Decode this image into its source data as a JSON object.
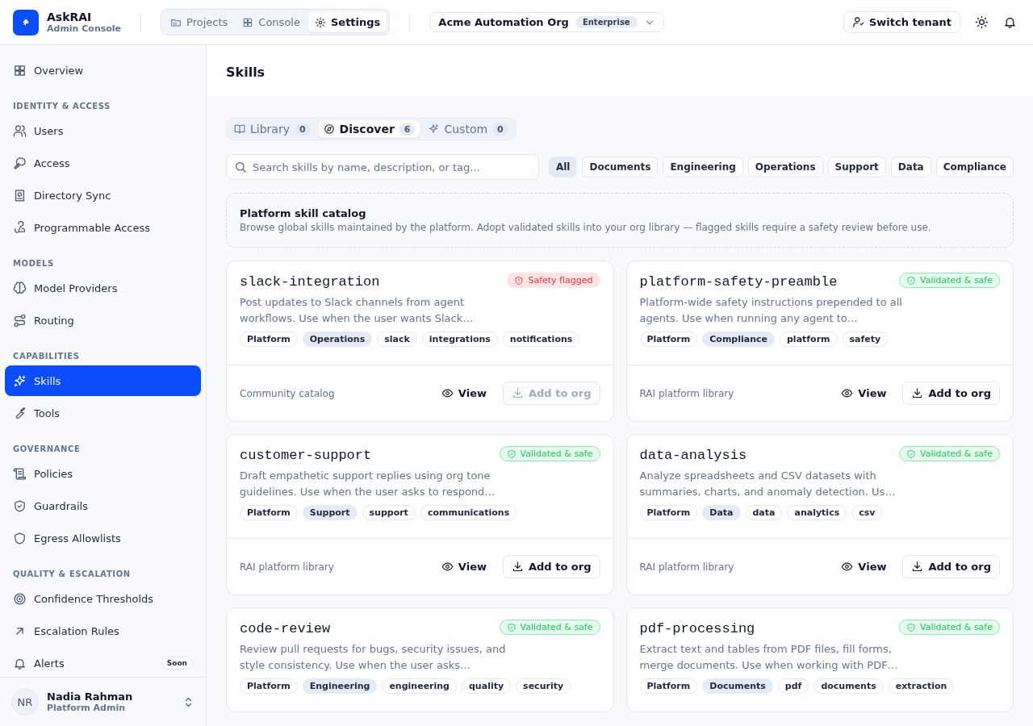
{
  "brand": {
    "name": "AskRAI",
    "subtitle": "Admin Console"
  },
  "nav_tabs": [
    {
      "label": "Projects",
      "selected": false
    },
    {
      "label": "Console",
      "selected": false
    },
    {
      "label": "Settings",
      "selected": true
    }
  ],
  "org_select": {
    "value": "Acme Automation Org",
    "badge": "Enterprise"
  },
  "switch_tenant": "Switch tenant",
  "sidebar": {
    "sections": [
      {
        "items": [
          {
            "label": "Overview",
            "selected": false
          }
        ]
      },
      {
        "title": "IDENTITY & ACCESS",
        "items": [
          {
            "label": "Users",
            "selected": false
          },
          {
            "label": "Access",
            "selected": false
          },
          {
            "label": "Directory Sync",
            "selected": false
          },
          {
            "label": "Programmable Access",
            "selected": false
          }
        ]
      },
      {
        "title": "MODELS",
        "items": [
          {
            "label": "Model Providers",
            "selected": false
          },
          {
            "label": "Routing",
            "selected": false
          }
        ]
      },
      {
        "title": "CAPABILITIES",
        "items": [
          {
            "label": "Skills",
            "selected": true
          },
          {
            "label": "Tools",
            "selected": false
          }
        ]
      },
      {
        "title": "GOVERNANCE",
        "items": [
          {
            "label": "Policies",
            "selected": false
          },
          {
            "label": "Guardrails",
            "selected": false
          },
          {
            "label": "Egress Allowlists",
            "selected": false
          }
        ]
      },
      {
        "title": "QUALITY & ESCALATION",
        "items": [
          {
            "label": "Confidence Thresholds",
            "selected": false
          },
          {
            "label": "Escalation Rules",
            "selected": false
          },
          {
            "label": "Alerts",
            "selected": false,
            "badge": "Soon"
          }
        ]
      }
    ],
    "user": {
      "initials": "NR",
      "name": "Nadia Rahman",
      "role": "Platform Admin"
    }
  },
  "page_title": "Skills",
  "skill_tabs": [
    {
      "label": "Library",
      "count": "0",
      "selected": false
    },
    {
      "label": "Discover",
      "count": "6",
      "selected": true
    },
    {
      "label": "Custom",
      "count": "0",
      "selected": false
    }
  ],
  "search": {
    "placeholder": "Search skills by name, description, or tag..."
  },
  "filters": [
    {
      "label": "All",
      "selected": true
    },
    {
      "label": "Documents",
      "selected": false
    },
    {
      "label": "Engineering",
      "selected": false
    },
    {
      "label": "Operations",
      "selected": false
    },
    {
      "label": "Support",
      "selected": false
    },
    {
      "label": "Data",
      "selected": false
    },
    {
      "label": "Compliance",
      "selected": false
    }
  ],
  "notice": {
    "title": "Platform skill catalog",
    "text": "Browse global skills maintained by the platform. Adopt validated skills into your org library — flagged skills require a safety review before use."
  },
  "skills": [
    {
      "name": "slack-integration",
      "status": {
        "kind": "flagged",
        "label": "Safety flagged"
      },
      "description": "Post updates to Slack channels from agent workflows. Use when the user wants Slack…",
      "tags": [
        {
          "label": "Platform",
          "kind": "source"
        },
        {
          "label": "Operations",
          "kind": "category"
        },
        {
          "label": "slack",
          "kind": "tag"
        },
        {
          "label": "integrations",
          "kind": "tag"
        },
        {
          "label": "notifications",
          "kind": "tag"
        }
      ],
      "footer": {
        "source": "Community catalog",
        "view": "View",
        "add": "Add to org",
        "add_disabled": true
      }
    },
    {
      "name": "platform-safety-preamble",
      "status": {
        "kind": "validated",
        "label": "Validated & safe"
      },
      "description": "Platform-wide safety instructions prepended to all agents. Use when running any agent to…",
      "tags": [
        {
          "label": "Platform",
          "kind": "source"
        },
        {
          "label": "Compliance",
          "kind": "category"
        },
        {
          "label": "platform",
          "kind": "tag"
        },
        {
          "label": "safety",
          "kind": "tag"
        }
      ],
      "footer": {
        "source": "RAI platform library",
        "view": "View",
        "add": "Add to org",
        "add_disabled": false
      }
    },
    {
      "name": "customer-support",
      "status": {
        "kind": "validated",
        "label": "Validated & safe"
      },
      "description": "Draft empathetic support replies using org tone guidelines. Use when the user asks to respond…",
      "tags": [
        {
          "label": "Platform",
          "kind": "source"
        },
        {
          "label": "Support",
          "kind": "category"
        },
        {
          "label": "support",
          "kind": "tag"
        },
        {
          "label": "communications",
          "kind": "tag"
        }
      ],
      "footer": {
        "source": "RAI platform library",
        "view": "View",
        "add": "Add to org",
        "add_disabled": false
      }
    },
    {
      "name": "data-analysis",
      "status": {
        "kind": "validated",
        "label": "Validated & safe"
      },
      "description": "Analyze spreadsheets and CSV datasets with summaries, charts, and anomaly detection. Us…",
      "tags": [
        {
          "label": "Platform",
          "kind": "source"
        },
        {
          "label": "Data",
          "kind": "category"
        },
        {
          "label": "data",
          "kind": "tag"
        },
        {
          "label": "analytics",
          "kind": "tag"
        },
        {
          "label": "csv",
          "kind": "tag"
        }
      ],
      "footer": {
        "source": "RAI platform library",
        "view": "View",
        "add": "Add to org",
        "add_disabled": false
      }
    },
    {
      "name": "code-review",
      "status": {
        "kind": "validated",
        "label": "Validated & safe"
      },
      "description": "Review pull requests for bugs, security issues, and style consistency. Use when the user asks…",
      "tags": [
        {
          "label": "Platform",
          "kind": "source"
        },
        {
          "label": "Engineering",
          "kind": "category"
        },
        {
          "label": "engineering",
          "kind": "tag"
        },
        {
          "label": "quality",
          "kind": "tag"
        },
        {
          "label": "security",
          "kind": "tag"
        }
      ]
    },
    {
      "name": "pdf-processing",
      "status": {
        "kind": "validated",
        "label": "Validated & safe"
      },
      "description": "Extract text and tables from PDF files, fill forms, merge documents. Use when working with PDF…",
      "tags": [
        {
          "label": "Platform",
          "kind": "source"
        },
        {
          "label": "Documents",
          "kind": "category"
        },
        {
          "label": "pdf",
          "kind": "tag"
        },
        {
          "label": "documents",
          "kind": "tag"
        },
        {
          "label": "extraction",
          "kind": "tag"
        }
      ]
    }
  ]
}
